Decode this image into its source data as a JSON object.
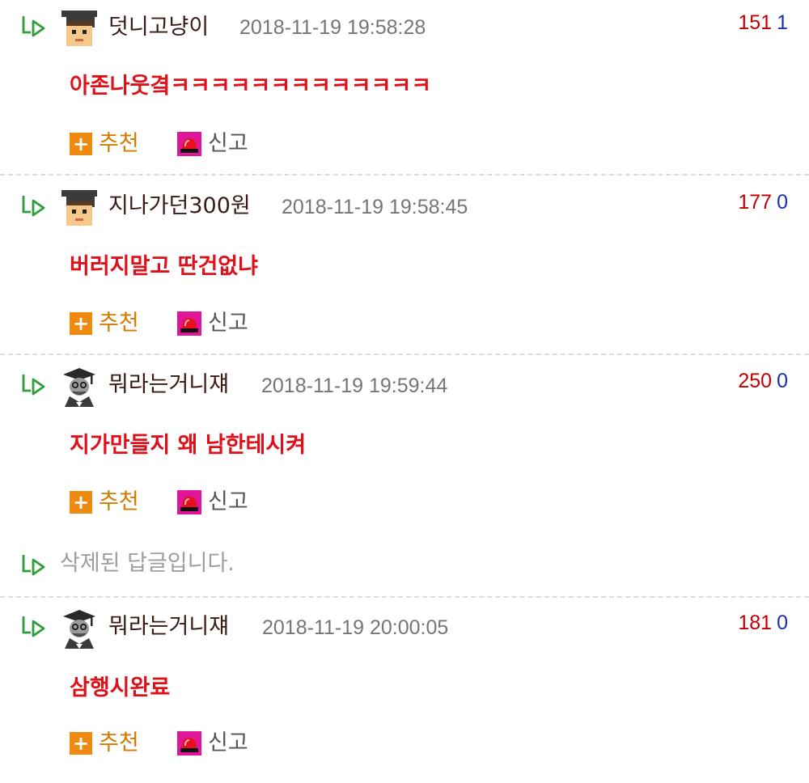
{
  "comments": [
    {
      "nickname": "덧니고냥이",
      "date": "2018-11-19 19:58:28",
      "up": "151",
      "down": "1",
      "body": "아존나웃곀ㅋㅋㅋㅋㅋㅋㅋㅋㅋㅋㅋㅋㅋ",
      "avatar": "graduate-cap-icon"
    },
    {
      "nickname": "지나가던300원",
      "date": "2018-11-19 19:58:45",
      "up": "177",
      "down": "0",
      "body": "버러지말고 딴건없냐",
      "avatar": "graduate-cap-icon"
    },
    {
      "nickname": "뭐라는거니쟤",
      "date": "2018-11-19 19:59:44",
      "up": "250",
      "down": "0",
      "body": "지가만들지 왜 남한테시켜",
      "avatar": "professor-icon"
    },
    {
      "nickname": "뭐라는거니쟤",
      "date": "2018-11-19 20:00:05",
      "up": "181",
      "down": "0",
      "body": "삼행시완료",
      "avatar": "professor-icon"
    }
  ],
  "deleted_text": "삭제된 답글입니다.",
  "actions": {
    "recommend": "추천",
    "report": "신고",
    "plus_symbol": "+"
  },
  "colors": {
    "body": "#e0101a",
    "up": "#c00000",
    "down": "#1a2fb0",
    "recommend": "#ef8a10",
    "reply_arrow": "#2e9e3a"
  }
}
